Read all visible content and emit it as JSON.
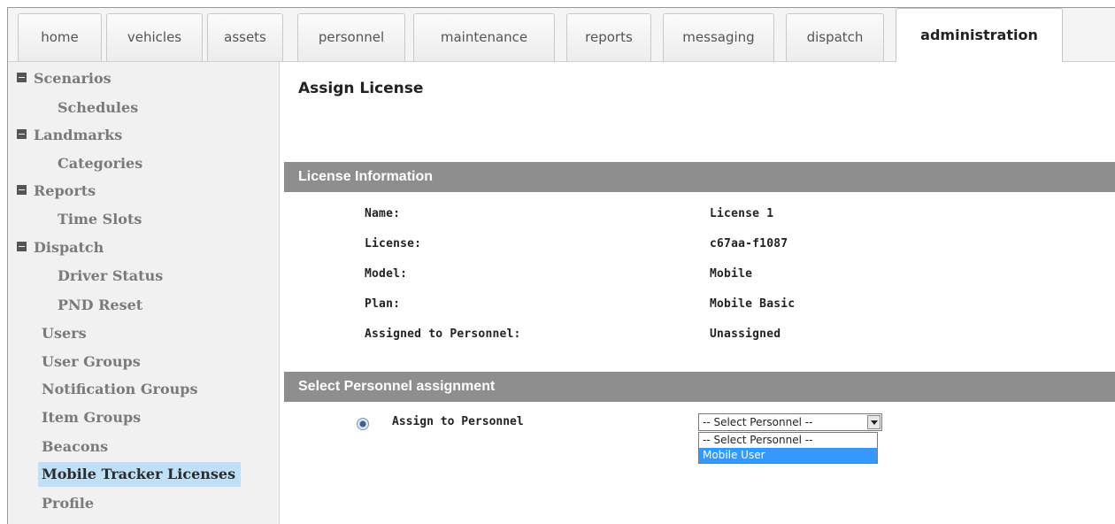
{
  "tabs": [
    {
      "label": "home"
    },
    {
      "label": "vehicles"
    },
    {
      "label": "assets"
    },
    {
      "label": "personnel"
    },
    {
      "label": "maintenance"
    },
    {
      "label": "reports"
    },
    {
      "label": "messaging"
    },
    {
      "label": "dispatch"
    },
    {
      "label": "administration",
      "active": true
    }
  ],
  "sidebar": {
    "items": [
      {
        "label": "Scenarios",
        "collapsible": true
      },
      {
        "label": "Schedules"
      },
      {
        "label": "Landmarks",
        "collapsible": true
      },
      {
        "label": "Categories"
      },
      {
        "label": "Reports",
        "collapsible": true
      },
      {
        "label": "Time Slots"
      },
      {
        "label": "Dispatch",
        "collapsible": true
      },
      {
        "label": "Driver Status"
      },
      {
        "label": "PND Reset"
      },
      {
        "label": "Users"
      },
      {
        "label": "User Groups"
      },
      {
        "label": "Notification Groups"
      },
      {
        "label": "Item Groups"
      },
      {
        "label": "Beacons"
      },
      {
        "label": "Mobile Tracker Licenses",
        "selected": true
      },
      {
        "label": "Profile"
      }
    ]
  },
  "main": {
    "title": "Assign License",
    "license_section": {
      "heading": "License Information",
      "rows": [
        {
          "label": "Name:",
          "value": "License 1"
        },
        {
          "label": "License:",
          "value": "c67aa-f1087"
        },
        {
          "label": "Model:",
          "value": "Mobile"
        },
        {
          "label": "Plan:",
          "value": "Mobile Basic"
        },
        {
          "label": "Assigned to Personnel:",
          "value": "Unassigned"
        }
      ]
    },
    "assignment_section": {
      "heading": "Select Personnel assignment",
      "radio_label": "Assign to Personnel",
      "select_value": "-- Select Personnel --",
      "options": [
        "-- Select Personnel --",
        "Mobile User"
      ],
      "highlighted_option": "Mobile User"
    }
  },
  "colors": {
    "section_bar": "#8e8e8e",
    "selected_sidebar": "#bfe0f6",
    "option_highlight": "#3399ff"
  }
}
